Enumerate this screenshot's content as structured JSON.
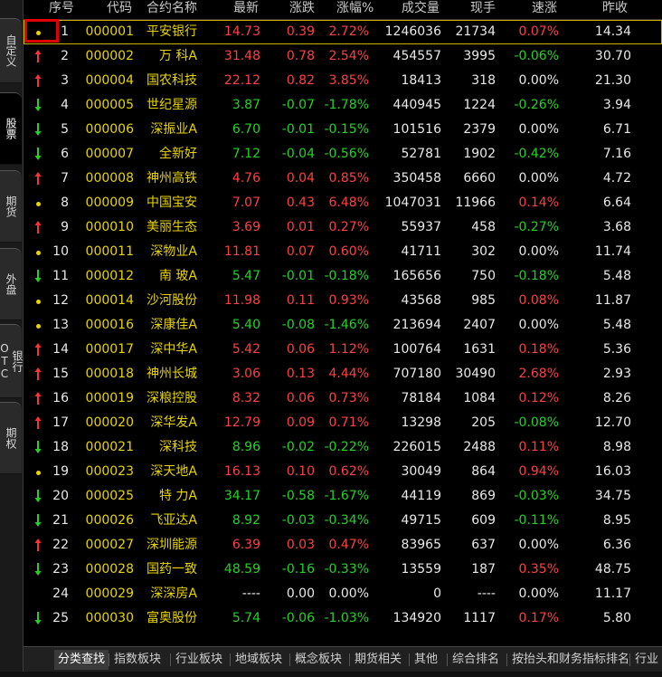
{
  "sidebar": {
    "tabs": [
      {
        "label": "自定义"
      },
      {
        "label": "股票"
      },
      {
        "label": "期货"
      },
      {
        "label": "外盘"
      },
      {
        "label": "银行OTC"
      },
      {
        "label": "期权"
      }
    ]
  },
  "columns": [
    "序号",
    "代码",
    "合约名称",
    "最新",
    "涨跌",
    "涨幅%",
    "成交量",
    "现手",
    "速涨",
    "昨收"
  ],
  "rows": [
    {
      "marker": "dot",
      "no": "1",
      "code": "000001",
      "name": "平安银行",
      "last": "14.73",
      "change": "0.39",
      "pct": "2.72%",
      "volume": "1246036",
      "hand": "21734",
      "speed": "0.07%",
      "prev": "14.34",
      "c_last": "red",
      "c_chg": "red",
      "c_speed": "red"
    },
    {
      "marker": "up",
      "no": "2",
      "code": "000002",
      "name": "万  科A",
      "last": "31.48",
      "change": "0.78",
      "pct": "2.54%",
      "volume": "454557",
      "hand": "3995",
      "speed": "-0.06%",
      "prev": "30.70",
      "c_last": "red",
      "c_chg": "red",
      "c_speed": "green"
    },
    {
      "marker": "up",
      "no": "3",
      "code": "000004",
      "name": "国农科技",
      "last": "22.12",
      "change": "0.82",
      "pct": "3.85%",
      "volume": "18413",
      "hand": "318",
      "speed": "0.00%",
      "prev": "21.30",
      "c_last": "red",
      "c_chg": "red",
      "c_speed": "white"
    },
    {
      "marker": "down",
      "no": "4",
      "code": "000005",
      "name": "世纪星源",
      "last": "3.87",
      "change": "-0.07",
      "pct": "-1.78%",
      "volume": "440945",
      "hand": "1224",
      "speed": "-0.26%",
      "prev": "3.94",
      "c_last": "green",
      "c_chg": "green",
      "c_speed": "green"
    },
    {
      "marker": "down",
      "no": "5",
      "code": "000006",
      "name": "深振业A",
      "last": "6.70",
      "change": "-0.01",
      "pct": "-0.15%",
      "volume": "101516",
      "hand": "2379",
      "speed": "0.00%",
      "prev": "6.71",
      "c_last": "green",
      "c_chg": "green",
      "c_speed": "white"
    },
    {
      "marker": "down",
      "no": "6",
      "code": "000007",
      "name": "全新好",
      "last": "7.12",
      "change": "-0.04",
      "pct": "-0.56%",
      "volume": "52781",
      "hand": "1902",
      "speed": "-0.42%",
      "prev": "7.16",
      "c_last": "green",
      "c_chg": "green",
      "c_speed": "green"
    },
    {
      "marker": "up",
      "no": "7",
      "code": "000008",
      "name": "神州高铁",
      "last": "4.76",
      "change": "0.04",
      "pct": "0.85%",
      "volume": "350458",
      "hand": "6660",
      "speed": "0.00%",
      "prev": "4.72",
      "c_last": "red",
      "c_chg": "red",
      "c_speed": "white"
    },
    {
      "marker": "dot",
      "no": "8",
      "code": "000009",
      "name": "中国宝安",
      "last": "7.07",
      "change": "0.43",
      "pct": "6.48%",
      "volume": "1047031",
      "hand": "11966",
      "speed": "0.14%",
      "prev": "6.64",
      "c_last": "red",
      "c_chg": "red",
      "c_speed": "red"
    },
    {
      "marker": "up",
      "no": "9",
      "code": "000010",
      "name": "美丽生态",
      "last": "3.69",
      "change": "0.01",
      "pct": "0.27%",
      "volume": "55937",
      "hand": "458",
      "speed": "-0.27%",
      "prev": "3.68",
      "c_last": "red",
      "c_chg": "red",
      "c_speed": "green"
    },
    {
      "marker": "dot",
      "no": "10",
      "code": "000011",
      "name": "深物业A",
      "last": "11.81",
      "change": "0.07",
      "pct": "0.60%",
      "volume": "41711",
      "hand": "302",
      "speed": "0.00%",
      "prev": "11.74",
      "c_last": "red",
      "c_chg": "red",
      "c_speed": "white"
    },
    {
      "marker": "down",
      "no": "11",
      "code": "000012",
      "name": "南  玻A",
      "last": "5.47",
      "change": "-0.01",
      "pct": "-0.18%",
      "volume": "165656",
      "hand": "750",
      "speed": "-0.18%",
      "prev": "5.48",
      "c_last": "green",
      "c_chg": "green",
      "c_speed": "green"
    },
    {
      "marker": "dot",
      "no": "12",
      "code": "000014",
      "name": "沙河股份",
      "last": "11.98",
      "change": "0.11",
      "pct": "0.93%",
      "volume": "43568",
      "hand": "985",
      "speed": "0.08%",
      "prev": "11.87",
      "c_last": "red",
      "c_chg": "red",
      "c_speed": "red"
    },
    {
      "marker": "dot",
      "no": "13",
      "code": "000016",
      "name": "深康佳A",
      "last": "5.40",
      "change": "-0.08",
      "pct": "-1.46%",
      "volume": "213694",
      "hand": "2407",
      "speed": "0.00%",
      "prev": "5.48",
      "c_last": "green",
      "c_chg": "green",
      "c_speed": "white"
    },
    {
      "marker": "up",
      "no": "14",
      "code": "000017",
      "name": "深中华A",
      "last": "5.42",
      "change": "0.06",
      "pct": "1.12%",
      "volume": "100764",
      "hand": "1631",
      "speed": "0.18%",
      "prev": "5.36",
      "c_last": "red",
      "c_chg": "red",
      "c_speed": "red"
    },
    {
      "marker": "up",
      "no": "15",
      "code": "000018",
      "name": "神州长城",
      "last": "3.06",
      "change": "0.13",
      "pct": "4.44%",
      "volume": "707180",
      "hand": "30490",
      "speed": "2.68%",
      "prev": "2.93",
      "c_last": "red",
      "c_chg": "red",
      "c_speed": "red"
    },
    {
      "marker": "up",
      "no": "16",
      "code": "000019",
      "name": "深粮控股",
      "last": "8.32",
      "change": "0.06",
      "pct": "0.73%",
      "volume": "78184",
      "hand": "1084",
      "speed": "0.12%",
      "prev": "8.26",
      "c_last": "red",
      "c_chg": "red",
      "c_speed": "red"
    },
    {
      "marker": "up",
      "no": "17",
      "code": "000020",
      "name": "深华发A",
      "last": "12.79",
      "change": "0.09",
      "pct": "0.71%",
      "volume": "13298",
      "hand": "205",
      "speed": "-0.08%",
      "prev": "12.70",
      "c_last": "red",
      "c_chg": "red",
      "c_speed": "green"
    },
    {
      "marker": "down",
      "no": "18",
      "code": "000021",
      "name": "深科技",
      "last": "8.96",
      "change": "-0.02",
      "pct": "-0.22%",
      "volume": "226015",
      "hand": "2488",
      "speed": "0.11%",
      "prev": "8.98",
      "c_last": "green",
      "c_chg": "green",
      "c_speed": "red"
    },
    {
      "marker": "dot",
      "no": "19",
      "code": "000023",
      "name": "深天地A",
      "last": "16.13",
      "change": "0.10",
      "pct": "0.62%",
      "volume": "30049",
      "hand": "864",
      "speed": "0.94%",
      "prev": "16.03",
      "c_last": "red",
      "c_chg": "red",
      "c_speed": "red"
    },
    {
      "marker": "down",
      "no": "20",
      "code": "000025",
      "name": "特  力A",
      "last": "34.17",
      "change": "-0.58",
      "pct": "-1.67%",
      "volume": "44119",
      "hand": "869",
      "speed": "-0.03%",
      "prev": "34.75",
      "c_last": "green",
      "c_chg": "green",
      "c_speed": "green"
    },
    {
      "marker": "down",
      "no": "21",
      "code": "000026",
      "name": "飞亚达A",
      "last": "8.92",
      "change": "-0.03",
      "pct": "-0.34%",
      "volume": "49715",
      "hand": "609",
      "speed": "-0.11%",
      "prev": "8.95",
      "c_last": "green",
      "c_chg": "green",
      "c_speed": "green"
    },
    {
      "marker": "up",
      "no": "22",
      "code": "000027",
      "name": "深圳能源",
      "last": "6.39",
      "change": "0.03",
      "pct": "0.47%",
      "volume": "83965",
      "hand": "637",
      "speed": "0.00%",
      "prev": "6.36",
      "c_last": "red",
      "c_chg": "red",
      "c_speed": "white"
    },
    {
      "marker": "down",
      "no": "23",
      "code": "000028",
      "name": "国药一致",
      "last": "48.59",
      "change": "-0.16",
      "pct": "-0.33%",
      "volume": "13559",
      "hand": "187",
      "speed": "0.35%",
      "prev": "48.75",
      "c_last": "green",
      "c_chg": "green",
      "c_speed": "red"
    },
    {
      "marker": "none",
      "no": "24",
      "code": "000029",
      "name": "深深房A",
      "last": "----",
      "change": "0.00",
      "pct": "0.00%",
      "volume": "0",
      "hand": "----",
      "speed": "0.00%",
      "prev": "11.17",
      "c_last": "white",
      "c_chg": "white",
      "c_speed": "white"
    },
    {
      "marker": "down",
      "no": "25",
      "code": "000030",
      "name": "富奥股份",
      "last": "5.74",
      "change": "-0.06",
      "pct": "-1.03%",
      "volume": "134920",
      "hand": "1117",
      "speed": "0.17%",
      "prev": "5.80",
      "c_last": "green",
      "c_chg": "green",
      "c_speed": "red"
    }
  ],
  "bottom_tabs": [
    "分类查找",
    "指数板块",
    "行业板块",
    "地域板块",
    "概念板块",
    "期货相关",
    "其他",
    "综合排名",
    "按抬头和财务指标排名",
    "行业"
  ],
  "colors": {
    "up": "#ff4040",
    "down": "#22d422",
    "flat": "#e8e8e8",
    "code": "#e8d400",
    "name": "#e8d400",
    "highlight": "#e00000"
  }
}
